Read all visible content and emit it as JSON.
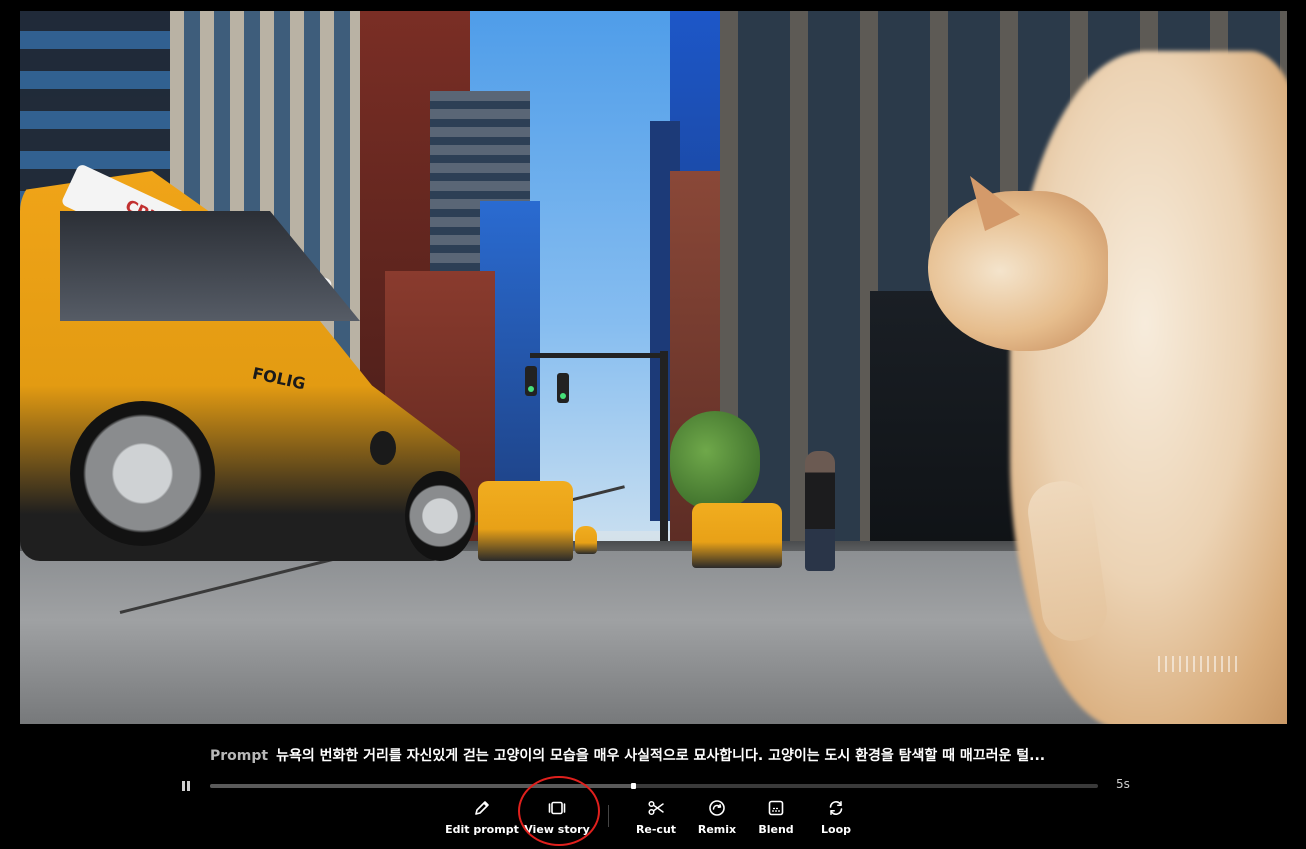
{
  "prompt": {
    "label": "Prompt",
    "text": "뉴욕의 번화한 거리를 자신있게 걷는 고양이의 모습을 매우 사실적으로 묘사합니다. 고양이는 도시 환경을 탐색할 때 매끄러운 털..."
  },
  "timeline": {
    "duration": "5s",
    "progress": 0.476
  },
  "toolbar": {
    "edit_prompt": "Edit prompt",
    "view_story": "View story",
    "recut": "Re-cut",
    "remix": "Remix",
    "blend": "Blend",
    "loop": "Loop"
  },
  "video": {
    "taxi_text": "FOLIG",
    "taxi_sign_text": "CPUO YORK"
  },
  "icons": {
    "pause": "pause-icon",
    "edit": "pencil-icon",
    "story": "storyboard-icon",
    "recut": "scissors-icon",
    "remix": "remix-icon",
    "blend": "blend-icon",
    "loop": "loop-icon"
  },
  "colors": {
    "background": "#000000",
    "annotation": "#e0201d",
    "taxi_yellow": "#f0a418"
  }
}
